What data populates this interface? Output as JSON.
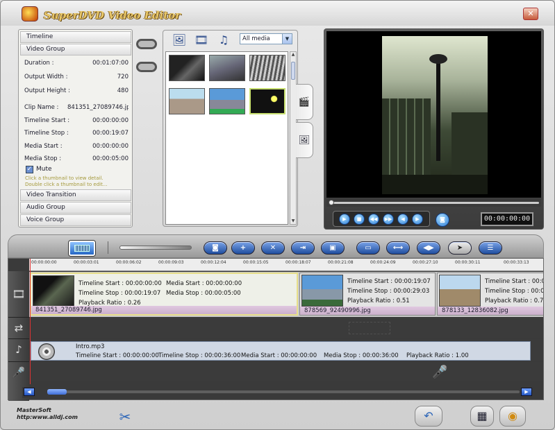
{
  "app": {
    "title": "SuperDVD Video Editor"
  },
  "left_panel": {
    "timeline_header": "Timeline",
    "video_group_header": "Video Group",
    "props": [
      {
        "label": "Duration :",
        "value": "00:01:07:00"
      },
      {
        "label": "Output Width :",
        "value": "720"
      },
      {
        "label": "Output Height :",
        "value": "480"
      },
      {
        "label": "Clip Name :",
        "value": "841351_27089746.jpg"
      },
      {
        "label": "Timeline Start :",
        "value": "00:00:00:00"
      },
      {
        "label": "Timeline Stop :",
        "value": "00:00:19:07"
      },
      {
        "label": "Media Start :",
        "value": "00:00:00:00"
      },
      {
        "label": "Media Stop :",
        "value": "00:00:05:00"
      }
    ],
    "mute_label": "Mute",
    "mute_checked": true,
    "hint1": "Click a thumbnail to view detail.",
    "hint2": "Double click a thumbnail to edit...",
    "video_transition": "Video Transition",
    "audio_group": "Audio Group",
    "voice_group": "Voice Group"
  },
  "media": {
    "filter_value": "All media",
    "tools": [
      "add-image-icon",
      "add-video-icon",
      "add-music-icon"
    ],
    "tabs": [
      "video-tab-icon",
      "photo-tab-icon"
    ]
  },
  "preview": {
    "timecode": "00:00:00:00"
  },
  "ruler": {
    "ticks": [
      "00:00:00:00",
      "00:00:03:01",
      "00:00:06:02",
      "00:00:09:03",
      "00:00:12:04",
      "00:00:15:05",
      "00:00:18:07",
      "00:00:21:08",
      "00:00:24:09",
      "00:00:27:10",
      "00:00:30:11",
      "00:00:33:13"
    ]
  },
  "timeline": {
    "clips": [
      {
        "name": "841351_27089746.jpg",
        "tl_start": "Timeline Start : 00:00:00:00",
        "tl_stop": "Timeline Stop : 00:00:19:07",
        "media_start": "Media Start : 00:00:00:00",
        "media_stop": "Media Stop : 00:00:05:00",
        "ratio": "Playback Ratio : 0.26"
      },
      {
        "name": "878569_92490996.jpg",
        "tl_start": "Timeline Start : 00:00:19:07",
        "tl_stop": "Timeline Stop : 00:00:29:03",
        "ratio": "Playback Ratio : 0.51"
      },
      {
        "name": "878133_12836082.jpg",
        "tl_start": "Timeline Start : 00:00:29:03",
        "tl_stop": "Timeline Stop : 00:00:...",
        "ratio": "Playback Ratio : 0.75"
      }
    ],
    "audio": {
      "name": "Intro.mp3",
      "tl_start": "Timeline Start : 00:00:00:00",
      "tl_stop": "Timeline Stop : 00:00:36:00",
      "media_start": "Media Start : 00:00:00:00",
      "media_stop": "Media Stop : 00:00:36:00",
      "ratio": "Playback Ratio : 1.00"
    }
  },
  "footer": {
    "brand_line1": "MasterSoft",
    "brand_line2": "http:www.alldj.com"
  }
}
